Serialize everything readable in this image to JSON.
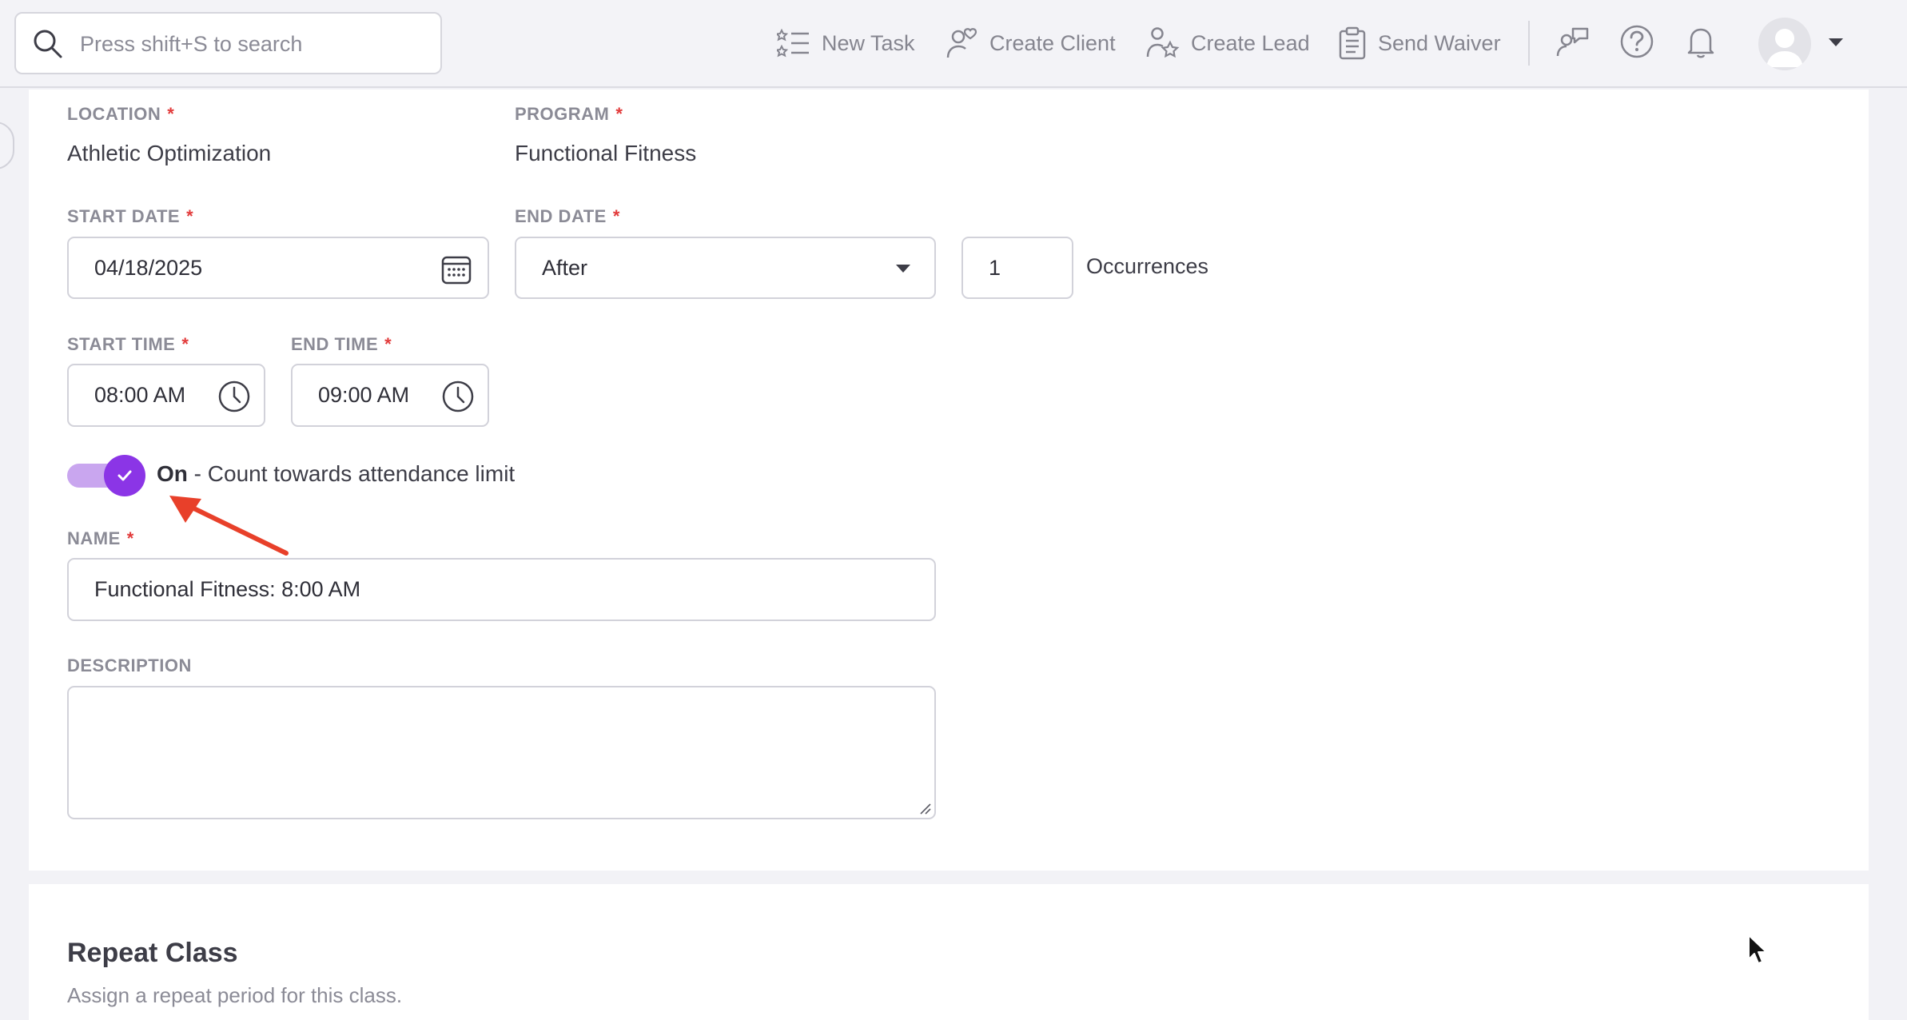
{
  "topbar": {
    "search_placeholder": "Press shift+S to search",
    "actions": {
      "new_task": "New Task",
      "create_client": "Create Client",
      "create_lead": "Create Lead",
      "send_waiver": "Send Waiver"
    },
    "icons": [
      "search-icon",
      "task-list-icon",
      "client-heart-icon",
      "lead-star-icon",
      "clipboard-icon",
      "feedback-icon",
      "help-icon",
      "bell-icon",
      "avatar",
      "caret-down-icon"
    ]
  },
  "form": {
    "location": {
      "label": "LOCATION",
      "required": "*",
      "value": "Athletic Optimization"
    },
    "program": {
      "label": "PROGRAM",
      "required": "*",
      "value": "Functional Fitness"
    },
    "start_date": {
      "label": "START DATE",
      "required": "*",
      "value": "04/18/2025"
    },
    "end_date": {
      "label": "END DATE",
      "required": "*",
      "value": "After"
    },
    "occurrences": {
      "value": "1",
      "suffix": "Occurrences"
    },
    "start_time": {
      "label": "START TIME",
      "required": "*",
      "value": "08:00 AM"
    },
    "end_time": {
      "label": "END TIME",
      "required": "*",
      "value": "09:00 AM"
    },
    "attendance_toggle": {
      "state": "On",
      "text": " - Count towards attendance limit",
      "checked": true
    },
    "name": {
      "label": "NAME",
      "required": "*",
      "value": "Functional Fitness: 8:00 AM"
    },
    "description": {
      "label": "DESCRIPTION",
      "value": ""
    }
  },
  "repeat_section": {
    "title": "Repeat Class",
    "subtitle": "Assign a repeat period for this class."
  },
  "colors": {
    "accent": "#8b35e6",
    "accent_light": "#c9a6ef",
    "required": "#e23b3b",
    "annotation_arrow": "#e8402a"
  }
}
